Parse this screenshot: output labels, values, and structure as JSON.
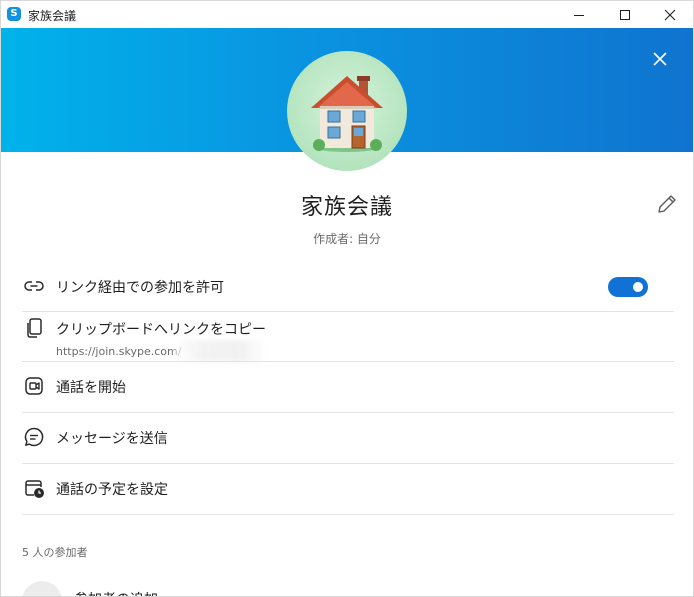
{
  "window": {
    "title": "家族会議",
    "app_icon_letter": "S",
    "controls": [
      "minimize-icon",
      "maximize-icon",
      "close-icon"
    ]
  },
  "header": {
    "banner_gradient": [
      "#00b2ea",
      "#0f74cf"
    ],
    "close_icon": "close-icon",
    "avatar_icon": "house-emoji"
  },
  "group": {
    "name": "家族会議",
    "creator": "作成者: 自分",
    "edit_icon": "pencil-icon"
  },
  "options": {
    "allow_join_link": {
      "label": "リンク経由での参加を許可",
      "icon": "link-icon",
      "toggle_on": true
    },
    "copy_link": {
      "label": "クリップボードへリンクをコピー",
      "icon": "copy-icon",
      "url": "https://join.skype.com/"
    },
    "start_call": {
      "label": "通話を開始",
      "icon": "video-call-icon"
    },
    "send_message": {
      "label": "メッセージを送信",
      "icon": "chat-icon"
    },
    "schedule_call": {
      "label": "通話の予定を設定",
      "icon": "calendar-clock-icon"
    }
  },
  "participants": {
    "header": "5 人の参加者",
    "add_label": "参加者の追加"
  },
  "colors": {
    "accent": "#1172d6",
    "divider": "#e3e3e3",
    "secondary_text": "#6a6a6a"
  }
}
